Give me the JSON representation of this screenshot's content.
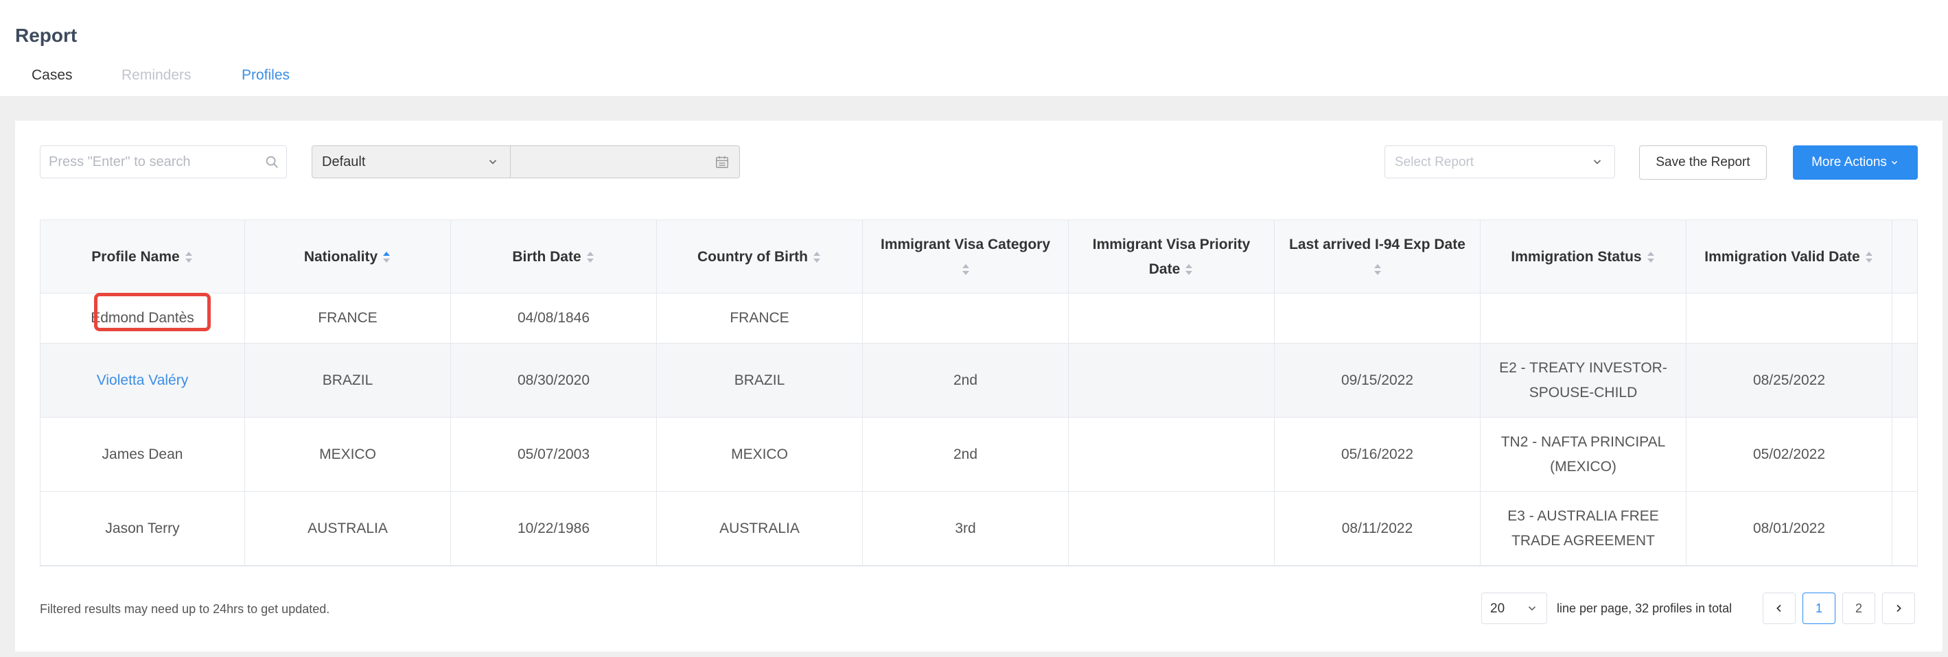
{
  "header": {
    "title": "Report",
    "tabs": [
      {
        "label": "Cases",
        "state": "default"
      },
      {
        "label": "Reminders",
        "state": "disabled"
      },
      {
        "label": "Profiles",
        "state": "active"
      }
    ]
  },
  "toolbar": {
    "search_placeholder": "Press \"Enter\" to search",
    "search_value": "",
    "date_type_value": "Default",
    "date_range_value": "",
    "select_report_placeholder": "Select Report",
    "save_label": "Save the Report",
    "more_actions_label": "More Actions"
  },
  "table": {
    "columns": [
      {
        "label": "Profile Name",
        "sort": "none"
      },
      {
        "label": "Nationality",
        "sort": "ascending"
      },
      {
        "label": "Birth Date",
        "sort": "none"
      },
      {
        "label": "Country of Birth",
        "sort": "none"
      },
      {
        "label": "Immigrant Visa Category",
        "sort": "none"
      },
      {
        "label": "Immigrant Visa Priority Date",
        "sort": "none"
      },
      {
        "label": "Last arrived I-94 Exp Date",
        "sort": "none"
      },
      {
        "label": "Immigration Status",
        "sort": "none"
      },
      {
        "label": "Immigration Valid Date",
        "sort": "none"
      }
    ],
    "rows": [
      {
        "name": "Edmond Dantès",
        "nationality": "FRANCE",
        "birth_date": "04/08/1846",
        "country_of_birth": "FRANCE",
        "visa_category": "",
        "priority_date": "",
        "i94_exp": "",
        "status": "",
        "valid_date": ""
      },
      {
        "name": "Violetta Valéry",
        "nationality": "BRAZIL",
        "birth_date": "08/30/2020",
        "country_of_birth": "BRAZIL",
        "visa_category": "2nd",
        "priority_date": "",
        "i94_exp": "09/15/2022",
        "status": "E2 - TREATY INVESTOR-SPOUSE-CHILD",
        "valid_date": "08/25/2022"
      },
      {
        "name": "James Dean",
        "nationality": "MEXICO",
        "birth_date": "05/07/2003",
        "country_of_birth": "MEXICO",
        "visa_category": "2nd",
        "priority_date": "",
        "i94_exp": "05/16/2022",
        "status": "TN2 - NAFTA PRINCIPAL (MEXICO)",
        "valid_date": "05/02/2022"
      },
      {
        "name": "Jason Terry",
        "nationality": "AUSTRALIA",
        "birth_date": "10/22/1986",
        "country_of_birth": "AUSTRALIA",
        "visa_category": "3rd",
        "priority_date": "",
        "i94_exp": "08/11/2022",
        "status": "E3 - AUSTRALIA FREE TRADE AGREEMENT",
        "valid_date": "08/01/2022"
      }
    ]
  },
  "footer": {
    "note": "Filtered results may need up to 24hrs to get updated.",
    "page_size": "20",
    "summary": "line per page, 32 profiles in total",
    "pages": [
      "1",
      "2"
    ],
    "current_page": "1"
  },
  "colors": {
    "accent": "#2d8cf0",
    "link": "#3a8ee6",
    "highlight": "#e8453c"
  }
}
